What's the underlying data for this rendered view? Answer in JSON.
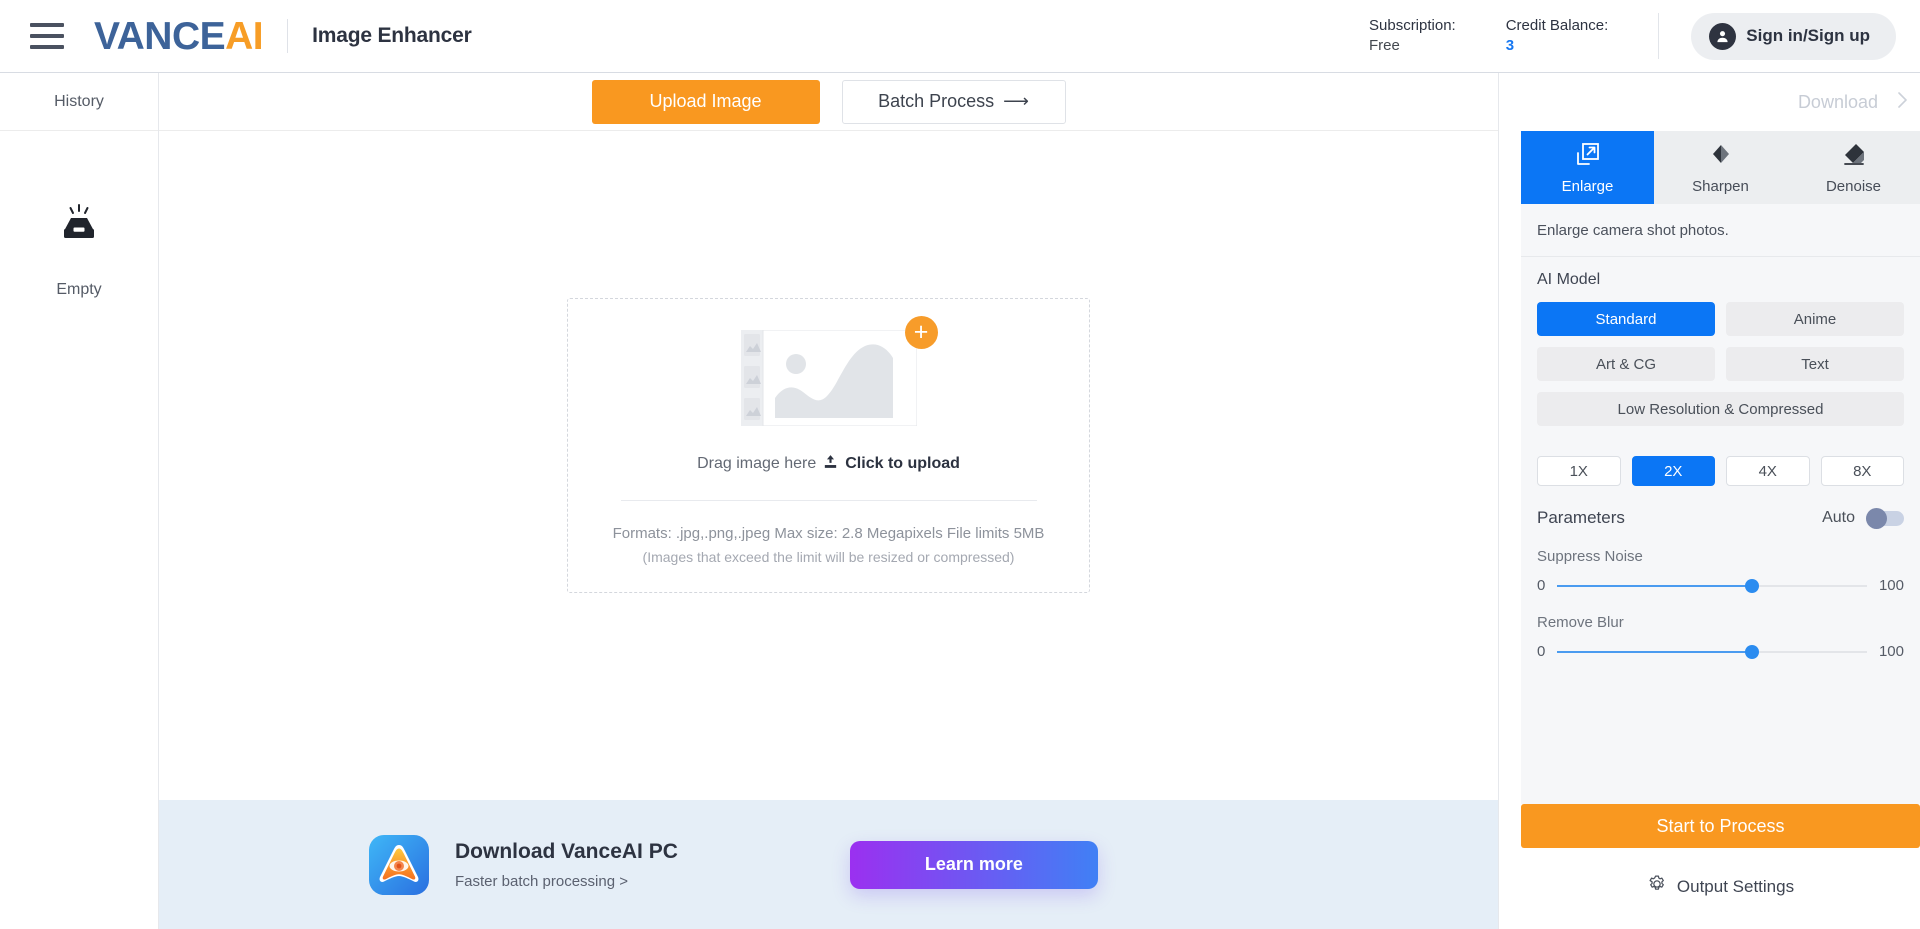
{
  "header": {
    "menu_icon": "hamburger-icon",
    "brand_part1": "VANCE",
    "brand_part2": "AI",
    "app_title": "Image Enhancer",
    "subscription_label": "Subscription:",
    "subscription_value": "Free",
    "credit_label": "Credit Balance:",
    "credit_value": "3",
    "signin_label": "Sign in/Sign up",
    "avatar_icon": "user-avatar-icon",
    "brand_color_primary": "#3d6399",
    "brand_color_accent": "#f79d26"
  },
  "sidebar": {
    "title": "History",
    "empty_icon": "inbox-empty-icon",
    "empty_label": "Empty"
  },
  "toolbar": {
    "upload_label": "Upload Image",
    "batch_label": "Batch Process",
    "batch_arrow": "⟶",
    "download_label": "Download",
    "download_chevron": "chevron-right-icon"
  },
  "dropzone": {
    "placeholder_icon": "image-placeholder-icon",
    "add_badge": "+",
    "drag_text": "Drag image here",
    "upload_icon": "upload-icon",
    "click_text": "Click to upload",
    "formats_line": "Formats: .jpg,.png,.jpeg Max size: 2.8 Megapixels File limits 5MB",
    "formats_note": "(Images that exceed the limit will be resized or compressed)"
  },
  "banner": {
    "logo_icon": "vanceai-pc-app-icon",
    "title": "Download VanceAI PC",
    "subtitle": "Faster batch processing >",
    "cta_label": "Learn more",
    "background": "#e5eef7",
    "cta_gradient_from": "#9b30f0",
    "cta_gradient_to": "#4080f5"
  },
  "panel": {
    "tabs": [
      {
        "label": "Enlarge",
        "icon": "enlarge-icon",
        "active": true
      },
      {
        "label": "Sharpen",
        "icon": "sharpen-icon",
        "active": false
      },
      {
        "label": "Denoise",
        "icon": "denoise-eraser-icon",
        "active": false
      }
    ],
    "description": "Enlarge camera shot photos.",
    "model_section_title": "AI Model",
    "models": [
      {
        "label": "Standard",
        "active": true
      },
      {
        "label": "Anime",
        "active": false
      },
      {
        "label": "Art & CG",
        "active": false
      },
      {
        "label": "Text",
        "active": false
      },
      {
        "label": "Low Resolution & Compressed",
        "active": false
      }
    ],
    "scales": [
      {
        "label": "1X",
        "active": false
      },
      {
        "label": "2X",
        "active": true
      },
      {
        "label": "4X",
        "active": false
      },
      {
        "label": "8X",
        "active": false
      }
    ],
    "parameters_title": "Parameters",
    "auto_label": "Auto",
    "auto_on": false,
    "sliders": [
      {
        "label": "Suppress Noise",
        "min": "0",
        "max": "100",
        "percent": 63
      },
      {
        "label": "Remove Blur",
        "min": "0",
        "max": "100",
        "percent": 63
      }
    ],
    "start_label": "Start to Process",
    "output_settings_label": "Output Settings",
    "gear_icon": "gear-icon",
    "accent_blue": "#0b76f5",
    "accent_orange": "#f99820"
  }
}
